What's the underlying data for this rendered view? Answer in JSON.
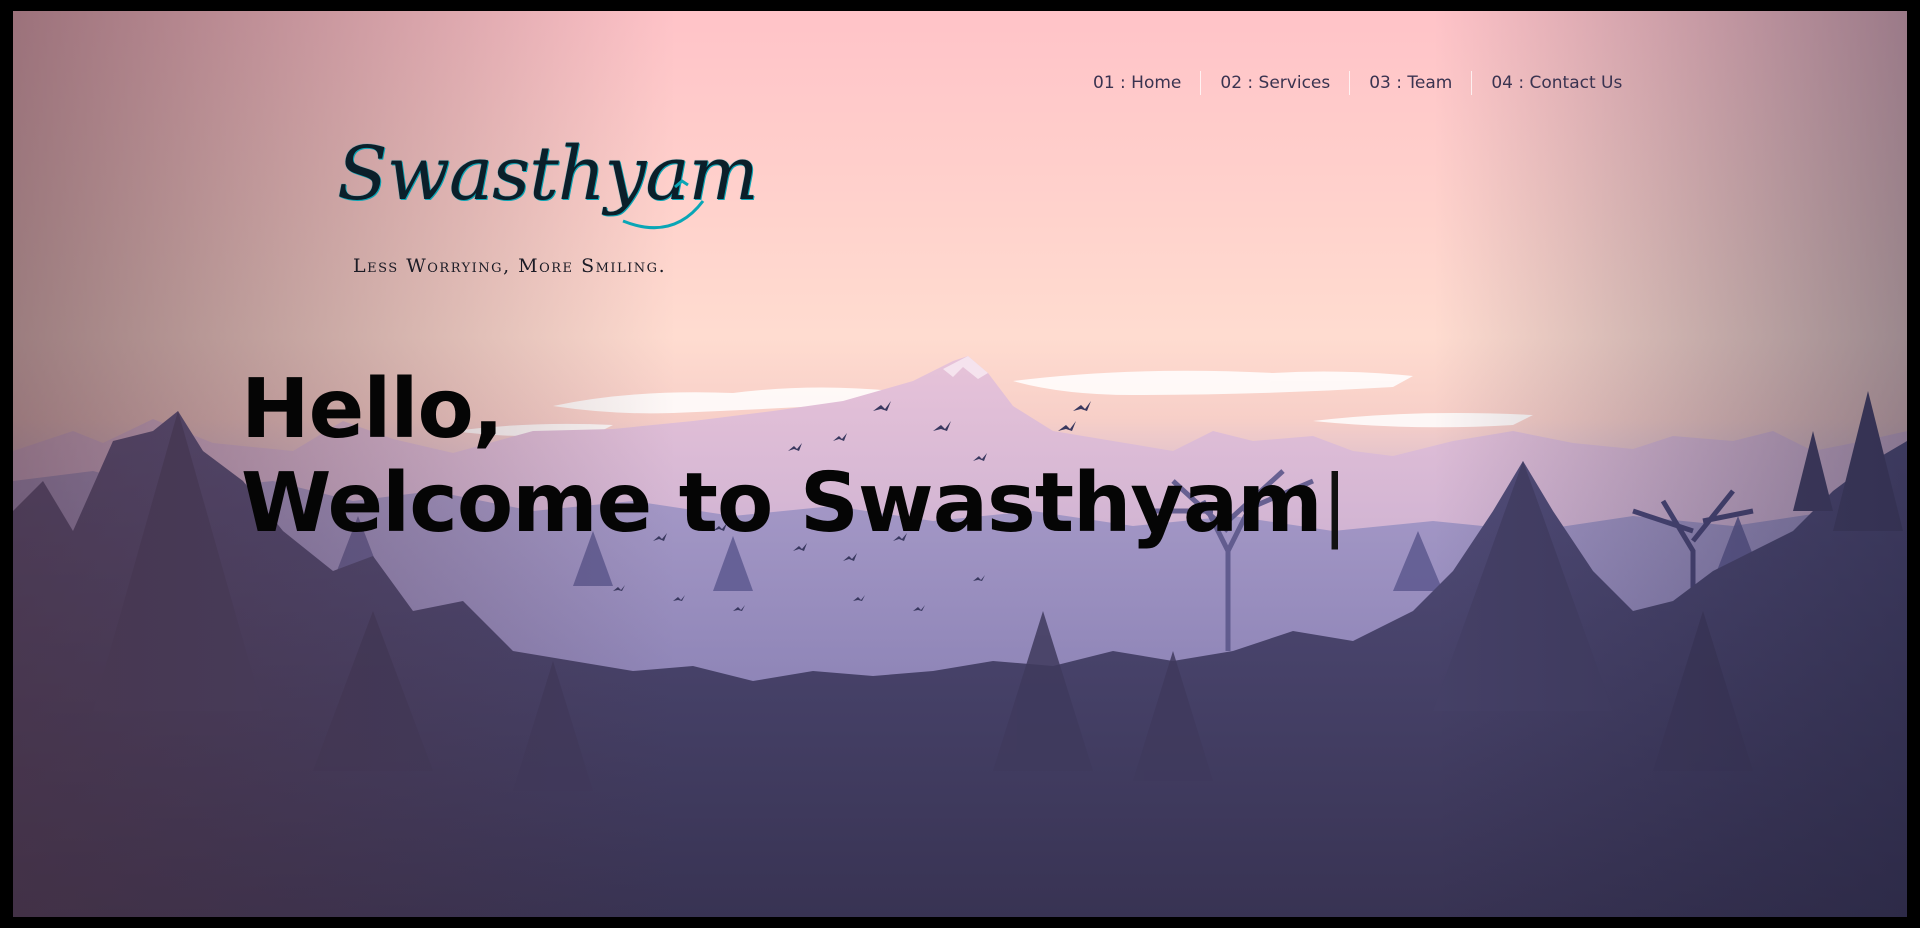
{
  "nav": {
    "items": [
      {
        "label": "01 : Home"
      },
      {
        "label": "02 : Services"
      },
      {
        "label": "03 : Team"
      },
      {
        "label": "04 : Contact Us"
      }
    ]
  },
  "logo": {
    "wordmark": "Swasthyam",
    "tagline": "Less Worrying, More Smiling."
  },
  "hero": {
    "greeting": "Hello,",
    "headline": "Welcome to Swasthyam",
    "cursor": "|"
  },
  "colors": {
    "sky_top": "#ffc3c8",
    "sky_mid": "#ffdcd0",
    "mountain": "#b5a0c8",
    "forest": "#4a4670",
    "text": "#050505",
    "logo_accent": "#0aa6b6"
  }
}
